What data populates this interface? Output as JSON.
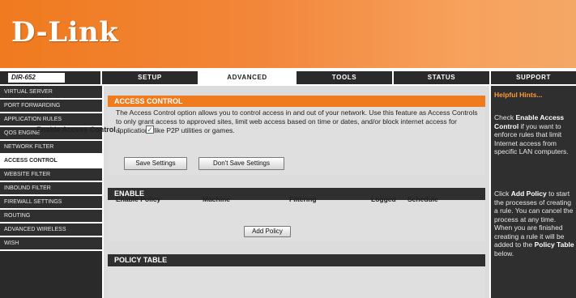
{
  "brand": {
    "logo": "D-Link",
    "model": "DIR-652",
    "slashes": "///"
  },
  "nav": {
    "tabs": [
      "SETUP",
      "ADVANCED",
      "TOOLS",
      "STATUS",
      "SUPPORT"
    ],
    "active": "ADVANCED"
  },
  "sidebar": {
    "items": [
      "VIRTUAL SERVER",
      "PORT FORWARDING",
      "APPLICATION RULES",
      "QOS ENGINE",
      "NETWORK FILTER",
      "ACCESS CONTROL",
      "WEBSITE FILTER",
      "INBOUND FILTER",
      "FIREWALL SETTINGS",
      "ROUTING",
      "ADVANCED WIRELESS",
      "WISH"
    ],
    "active_index": 5
  },
  "access_control": {
    "title": "ACCESS CONTROL",
    "description": "The Access Control option allows you to control access in and out of your network. Use this feature as Access Controls to only grant access to approved sites, limit web access based on time or dates, and/or block internet access for applications like P2P utilities or games.",
    "save_label": "Save Settings",
    "dont_save_label": "Don't Save Settings"
  },
  "enable_section": {
    "title": "ENABLE",
    "enable_label": "Enable Access Control :",
    "enable_checked": true,
    "checkmark": "✓",
    "add_policy_label": "Add Policy"
  },
  "policy_table": {
    "title": "POLICY TABLE",
    "columns": [
      "Enable Policy",
      "Machine",
      "Filtering",
      "Logged",
      "Schedule"
    ]
  },
  "help": {
    "title": "Helpful Hints...",
    "p1_pre": "Check ",
    "p1_bold": "Enable Access Control",
    "p1_post": " if you want to enforce rules that limit Internet access from specific LAN computers.",
    "p2_pre": "Click ",
    "p2_bold": "Add Policy",
    "p2_mid": " to start the processes of creating a rule. You can cancel the process at any time. When you are finished creating a rule it will be added to the ",
    "p2_bold2": "Policy Table",
    "p2_post": " below."
  },
  "colors": {
    "accent": "#f07a1e",
    "dark": "#2f2f2f",
    "panel": "#dfdfdf"
  }
}
